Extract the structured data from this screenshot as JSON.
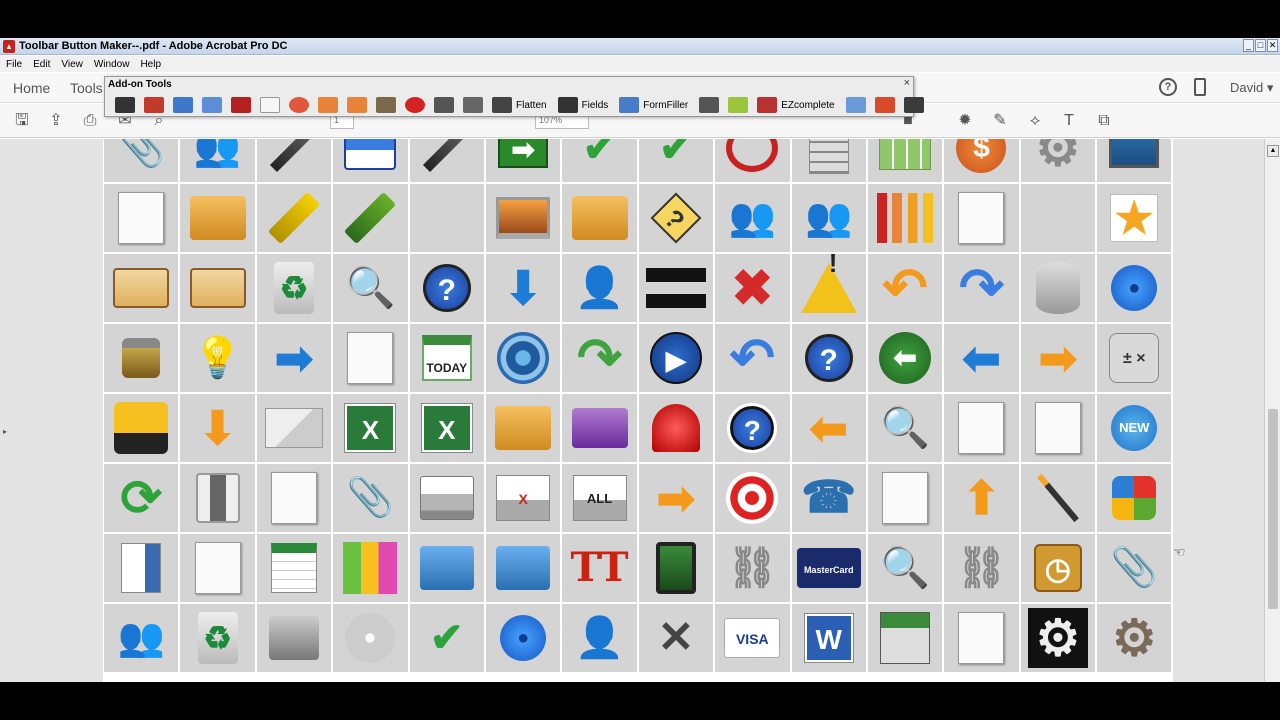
{
  "window": {
    "title": "Toolbar Button Maker--.pdf - Adobe Acrobat Pro DC",
    "controls": [
      "_",
      "□",
      "✕"
    ]
  },
  "menu": [
    "File",
    "Edit",
    "View",
    "Window",
    "Help"
  ],
  "nav": {
    "home": "Home",
    "tools": "Tools",
    "user": "David"
  },
  "page_controls": {
    "page_number": "1",
    "zoom": "107%"
  },
  "addon": {
    "title": "Add-on Tools",
    "close": "×",
    "labels": {
      "flatten": "Flatten",
      "fields": "Fields",
      "formfiller": "FormFiller",
      "ezcomplete": "EZcomplete"
    }
  },
  "icon_grid": {
    "rows": [
      [
        "paperclip-icon",
        "users-icon",
        "pencils-icon",
        "floppy-disk-icon",
        "pen-icon",
        "exit-icon",
        "checkmark-icon",
        "checkmark-icon",
        "no-entry-icon",
        "calculator-icon",
        "spreadsheet-icon",
        "dollar-icon",
        "gear-icon",
        "monitor-icon"
      ],
      [
        "document-icon",
        "folder-gear-icon",
        "highlighter-icon",
        "marker-icon",
        "bank-icon",
        "laptop-icon",
        "folder-settings-icon",
        "question-diamond-icon",
        "group-icon",
        "people-icon",
        "bar-chart-icon",
        "line-chart-icon",
        "bank-columns-icon",
        "star-icon"
      ],
      [
        "id-card-icon",
        "vcard-icon",
        "recycle-bin-icon",
        "magnifier-icon",
        "help-icon",
        "arrow-down-icon",
        "user-icon",
        "equals-icon",
        "red-x-icon",
        "warning-icon",
        "undo-arrow-icon",
        "redo-arrow-icon",
        "database-icon",
        "blue-face-icon"
      ],
      [
        "padlock-icon",
        "lightbulb-icon",
        "arrow-right-icon",
        "clipboard-check-icon",
        "calendar-today-icon",
        "target-icon",
        "forward-arrow-icon",
        "play-icon",
        "back-arrow-icon",
        "question-circle-icon",
        "back-circle-icon",
        "arrow-left-icon",
        "arrow-right-orange-icon",
        "calculator-keys-icon"
      ],
      [
        "drill-icon",
        "arrow-down-orange-icon",
        "mail-icon",
        "excel-icon",
        "excel-keyboard-icon",
        "folder-gear-yellow-icon",
        "purple-folder-icon",
        "alarm-light-icon",
        "help-square-icon",
        "arrow-left-orange-icon",
        "search-page-icon",
        "save-name-icon",
        "text-page-icon",
        "new-badge-icon"
      ],
      [
        "refresh-icon",
        "switch-icon",
        "import-icon",
        "attachment-icon",
        "printer-icon",
        "print-x-icon",
        "print-all-icon",
        "arrow-right-orange-icon",
        "bullseye-icon",
        "telephone-icon",
        "checklist-icon",
        "arrow-up-orange-icon",
        "magic-wand-icon",
        "windows-logo-icon"
      ],
      [
        "bookmark-icon",
        "starred-list-icon",
        "calendar-icon",
        "buildings-icon",
        "folder-download-icon",
        "folder-share-icon",
        "font-icon",
        "tablet-icon",
        "link-add-icon",
        "mastercard-icon",
        "search-forward-icon",
        "link-remove-icon",
        "clock-icon",
        "paperclip-grey-icon"
      ],
      [
        "user-group-dark-icon",
        "trash-icon",
        "stamp-icon",
        "cd-icon",
        "check-green-icon",
        "blue-smile-icon",
        "silhouette-icon",
        "tools-icon",
        "visa-icon",
        "word-icon",
        "filing-icon",
        "pdf-icon",
        "gear-blue-icon",
        "wheel-icon"
      ]
    ]
  },
  "colors": {
    "accent_blue": "#1b5bb5",
    "accent_orange": "#f39a1c",
    "accent_red": "#d42a2a",
    "accent_green": "#2ea33a"
  },
  "overlay": {
    "today_label": "TODAY",
    "all_label": "ALL",
    "print_x_label": "X",
    "new_label": "NEW",
    "mastercard_label": "MasterCard",
    "visa_label": "VISA",
    "word_label": "W",
    "font_label": "TT"
  }
}
